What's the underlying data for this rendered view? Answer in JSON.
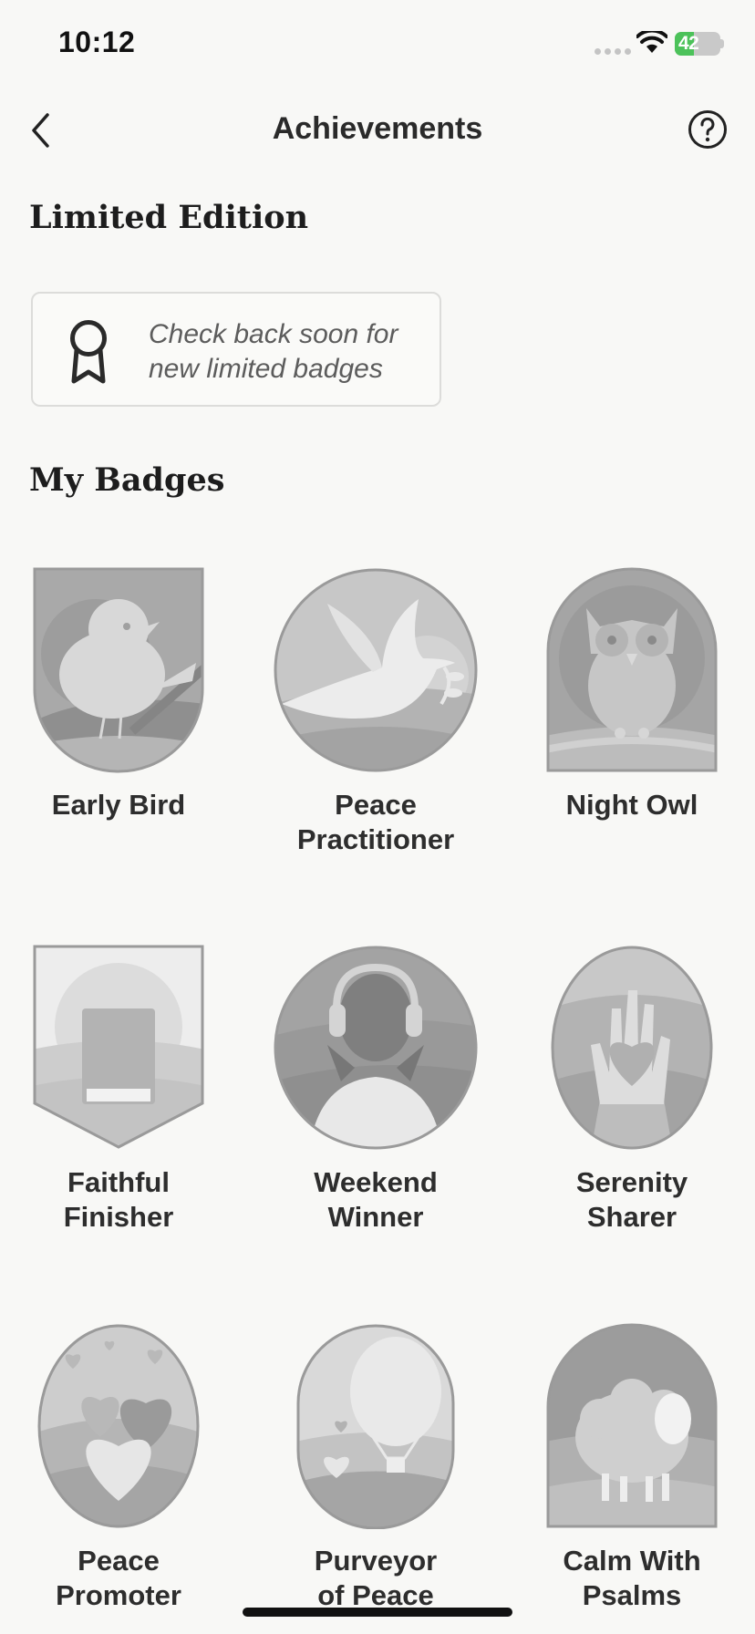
{
  "status_bar": {
    "time": "10:12",
    "battery": "42"
  },
  "nav": {
    "title": "Achievements"
  },
  "limited": {
    "title": "Limited Edition",
    "message_line1": "Check back soon for",
    "message_line2": "new limited badges"
  },
  "badges": {
    "title": "My Badges",
    "items": [
      {
        "line1": "Early Bird",
        "line2": ""
      },
      {
        "line1": "Peace",
        "line2": "Practitioner"
      },
      {
        "line1": "Night Owl",
        "line2": ""
      },
      {
        "line1": "Faithful",
        "line2": "Finisher"
      },
      {
        "line1": "Weekend",
        "line2": "Winner"
      },
      {
        "line1": "Serenity",
        "line2": "Sharer"
      },
      {
        "line1": "Peace",
        "line2": "Promoter"
      },
      {
        "line1": "Purveyor",
        "line2": "of Peace"
      },
      {
        "line1": "Calm With",
        "line2": "Psalms"
      }
    ]
  },
  "colors": {
    "accent_battery": "#4cc25a",
    "badge_locked": "#c8c8c8"
  }
}
